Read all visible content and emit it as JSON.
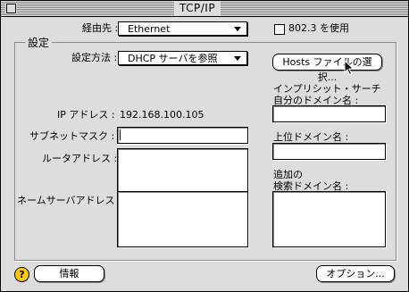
{
  "window": {
    "title": "TCP/IP"
  },
  "connect_via": {
    "label": "経由先 :",
    "value": "Ethernet"
  },
  "use_8023": {
    "label": "802.3 を使用",
    "checked": false
  },
  "settings": {
    "legend": "設定",
    "configure_label": "設定方法 :",
    "configure_value": "DHCP サーバを参照",
    "select_hosts_button": "Hosts ファイルの選択...",
    "ip_label": "IP アドレス :",
    "ip_value": "192.168.100.105",
    "subnet_label": "サブネットマスク :",
    "subnet_value": "",
    "router_label": "ルータアドレス :",
    "router_value": "",
    "nameserver_label": "ネームサーバアドレス :",
    "nameserver_value": "",
    "implicit_search_label_1": "インプリシット・サーチ",
    "implicit_search_label_2": "自分のドメイン名 :",
    "implicit_search_value": "",
    "admin_domain_label": "上位ドメイン名 :",
    "admin_domain_value": "",
    "search_domains_label_1": "追加の",
    "search_domains_label_2": "検索ドメイン名 :",
    "search_domains_value": ""
  },
  "footer": {
    "help_glyph": "?",
    "info_button": "情報",
    "options_button": "オプション..."
  }
}
